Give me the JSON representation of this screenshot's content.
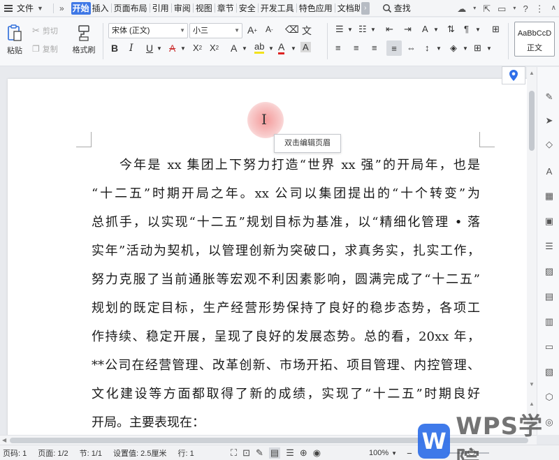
{
  "menubar": {
    "file_label": "文件",
    "more_label": "»",
    "tabs": [
      "开始",
      "插入",
      "页面布局",
      "引用",
      "审阅",
      "视图",
      "章节",
      "安全",
      "开发工具",
      "特色应用",
      "文档助"
    ],
    "active_tab": "开始",
    "search_label": "查找"
  },
  "ribbon": {
    "paste_label": "粘贴",
    "cut_label": "剪切",
    "copy_label": "复制",
    "format_painter_label": "格式刷",
    "font_name": "宋体 (正文)",
    "font_size": "小三",
    "style_sample": "AaBbCcD",
    "style_name": "正文"
  },
  "document": {
    "header_tooltip": "双击编辑页眉",
    "lines": [
      "今年是 xx 集团上下努力打造“世界 xx 强”的开局年，也是",
      "“十二五”时期开局之年。xx 公司以集团提出的“十个转变”为",
      "总抓手，以实现“十二五”规划目标为基准，以“精细化管理 • 落",
      "实年”活动为契机，以管理创新为突破口，求真务实，扎实工作，",
      "努力克服了当前通胀等宏观不利因素影响，圆满完成了“十二五”",
      "规划的既定目标，生产经营形势保持了良好的稳步态势，各项工",
      "作持续、稳定开展，呈现了良好的发展态势。总的看，20xx 年，",
      "**公司在经营管理、改革创新、市场开拓、项目管理、内控管理、",
      "文化建设等方面都取得了新的成绩，实现了“十二五”时期良好",
      "开局。主要表现在："
    ]
  },
  "status": {
    "page_num": "页码: 1",
    "pages": "页面: 1/2",
    "section": "节: 1/1",
    "setting": "设置值: 2.5厘米",
    "row": "行: 1",
    "zoom": "100%"
  },
  "watermark": {
    "logo_letter": "W",
    "text": "WPS学院"
  },
  "colors": {
    "accent": "#3f78e6",
    "brand": "#2f6fe9"
  }
}
